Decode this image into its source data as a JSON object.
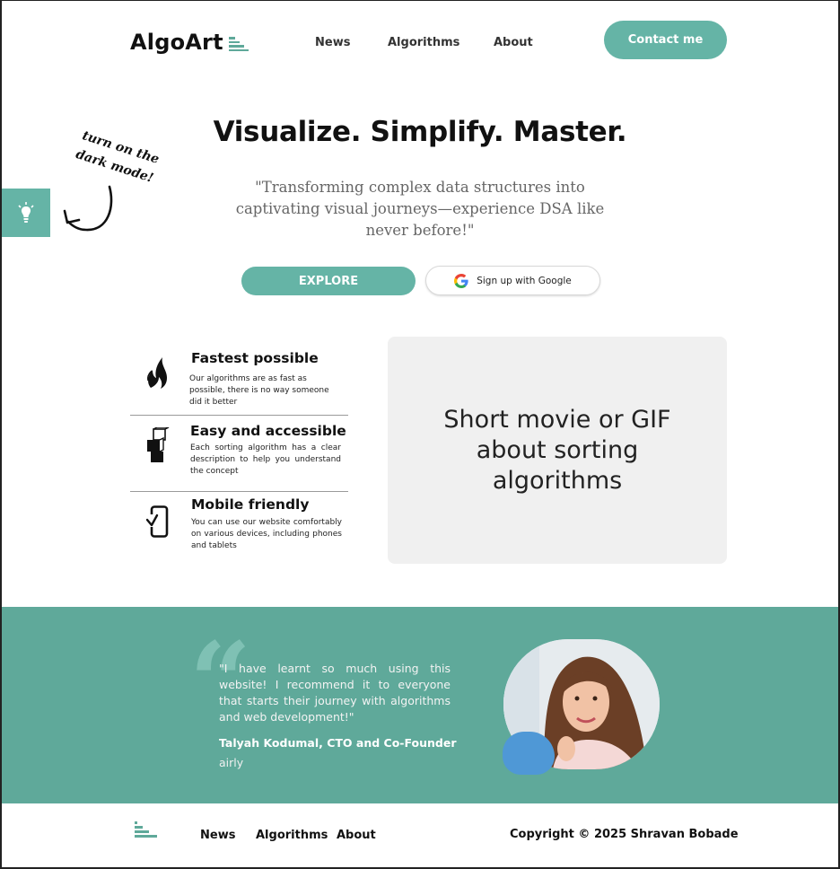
{
  "header": {
    "logo_text": "AlgoArt",
    "nav": [
      "News",
      "Algorithms",
      "About"
    ],
    "contact_label": "Contact me"
  },
  "hero": {
    "title": "Visualize. Simplify. Master.",
    "subtitle": "\"Transforming complex data structures into captivating visual journeys—experience DSA like never before!\"",
    "explore_label": "EXPLORE",
    "google_label": "Sign up with Google"
  },
  "dark_mode": {
    "note": "turn on the dark mode!",
    "icon": "lightbulb-icon"
  },
  "features": [
    {
      "icon": "flame-icon",
      "title": "Fastest possible",
      "description": "Our algorithms are as fast as possible, there is no way someone did it better"
    },
    {
      "icon": "blocks-icon",
      "title": "Easy and accessible",
      "description": "Each sorting algorithm has a clear description to help you understand the concept"
    },
    {
      "icon": "mobile-check-icon",
      "title": "Mobile friendly",
      "description": "You can use our website comfortably on various devices, including phones and tablets"
    }
  ],
  "media_placeholder": "Short movie or GIF about sorting algorithms",
  "testimonial": {
    "quote": "\"I have learnt so much using this website! I recommend it to everyone that starts their journey with algorithms and web development!\"",
    "author": "Talyah Kodumal, CTO and Co-Founder",
    "company": "airly"
  },
  "footer": {
    "nav": [
      "News",
      "Algorithms",
      "About"
    ],
    "copyright": "Copyright © 2025 Shravan Bobade"
  },
  "colors": {
    "accent": "#65b4a6",
    "testimonial_bg": "#5fa99a",
    "placeholder_bg": "#f0f0f0"
  }
}
